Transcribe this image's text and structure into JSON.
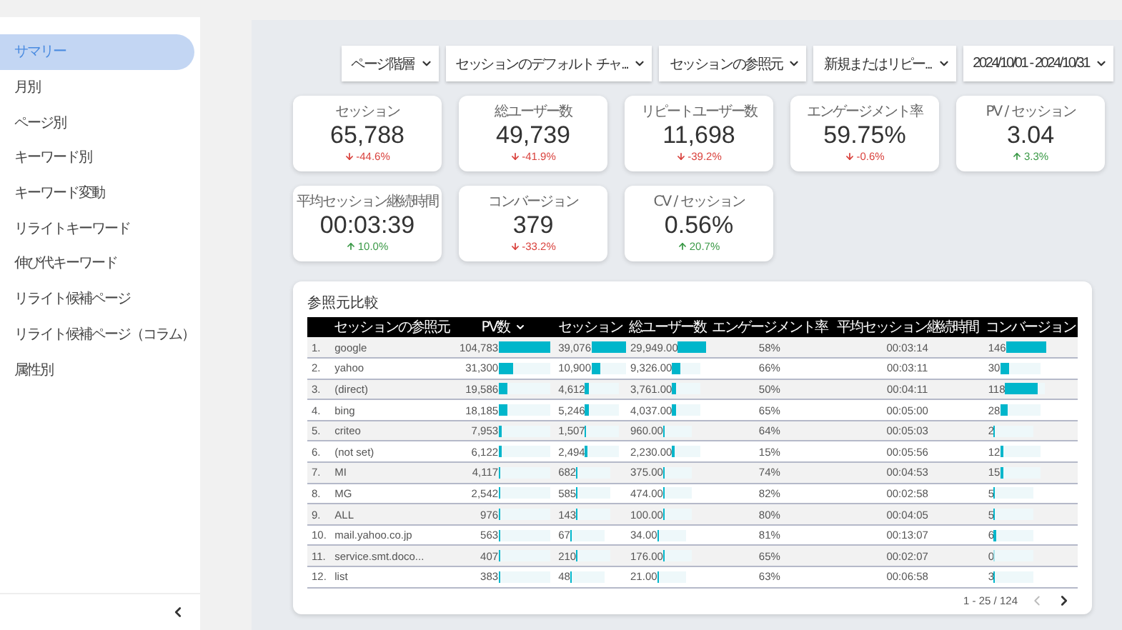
{
  "sidebar": {
    "items": [
      {
        "label": "サマリー",
        "selected": true
      },
      {
        "label": "月別",
        "selected": false
      },
      {
        "label": "ページ別",
        "selected": false
      },
      {
        "label": "キーワード別",
        "selected": false
      },
      {
        "label": "キーワード変動",
        "selected": false
      },
      {
        "label": "リライトキーワード",
        "selected": false
      },
      {
        "label": "伸び代キーワード",
        "selected": false
      },
      {
        "label": "リライト候補ページ",
        "selected": false
      },
      {
        "label": "リライト候補ページ（コラム）",
        "selected": false
      },
      {
        "label": "属性別",
        "selected": false
      }
    ]
  },
  "filters": [
    {
      "label": "ページ階層"
    },
    {
      "label": "セッションのデフォルト チャ..."
    },
    {
      "label": "セッションの参照元"
    },
    {
      "label": "新規またはリピー..."
    },
    {
      "label": "2024/10/01 - 2024/10/31"
    }
  ],
  "kpis": [
    {
      "label": "セッション",
      "value": "65,788",
      "delta": "-44.6%",
      "increase": false
    },
    {
      "label": "総ユーザー数",
      "value": "49,739",
      "delta": "-41.9%",
      "increase": false
    },
    {
      "label": "リピートユーザー数",
      "value": "11,698",
      "delta": "-39.2%",
      "increase": false
    },
    {
      "label": "エンゲージメント率",
      "value": "59.75%",
      "delta": "-0.6%",
      "increase": false
    },
    {
      "label": "PV / セッション",
      "value": "3.04",
      "delta": "3.3%",
      "increase": true
    },
    {
      "label": "平均セッション継続時間",
      "value": "00:03:39",
      "delta": "10.0%",
      "increase": true
    },
    {
      "label": "コンバージョン",
      "value": "379",
      "delta": "-33.2%",
      "increase": false
    },
    {
      "label": "CV / セッション",
      "value": "0.56%",
      "delta": "20.7%",
      "increase": true
    }
  ],
  "table": {
    "title": "参照元比較",
    "columns": [
      {
        "label": "セッションの参照元",
        "sorted": false
      },
      {
        "label": "PV数",
        "sorted": true
      },
      {
        "label": "セッション",
        "sorted": false
      },
      {
        "label": "総ユーザー数",
        "sorted": false
      },
      {
        "label": "エンゲージメント率",
        "sorted": false
      },
      {
        "label": "平均セッション継続時間",
        "sorted": false
      },
      {
        "label": "コンバージョン",
        "sorted": false
      }
    ],
    "rows": [
      {
        "index": "1.",
        "source": "google",
        "pv": {
          "text": "104,783",
          "level": 1
        },
        "sessions": {
          "text": "39,076",
          "level": 1
        },
        "users": {
          "text": "29,949.00",
          "level": 1
        },
        "engagement": "58%",
        "duration": "00:03:14",
        "conversions": {
          "text": "146",
          "level": 1
        }
      },
      {
        "index": "2.",
        "source": "yahoo",
        "pv": {
          "text": "31,300",
          "level": 0.3
        },
        "sessions": {
          "text": "10,900",
          "level": 0.28
        },
        "users": {
          "text": "9,326.00",
          "level": 0.31
        },
        "engagement": "66%",
        "duration": "00:03:11",
        "conversions": {
          "text": "30",
          "level": 0.21
        }
      },
      {
        "index": "3.",
        "source": "(direct)",
        "pv": {
          "text": "19,586",
          "level": 0.19
        },
        "sessions": {
          "text": "4,612",
          "level": 0.12
        },
        "users": {
          "text": "3,761.00",
          "level": 0.13
        },
        "engagement": "50%",
        "duration": "00:04:11",
        "conversions": {
          "text": "118",
          "level": 0.81
        }
      },
      {
        "index": "4.",
        "source": "bing",
        "pv": {
          "text": "18,185",
          "level": 0.17
        },
        "sessions": {
          "text": "5,246",
          "level": 0.13
        },
        "users": {
          "text": "4,037.00",
          "level": 0.13
        },
        "engagement": "65%",
        "duration": "00:05:00",
        "conversions": {
          "text": "28",
          "level": 0.19
        }
      },
      {
        "index": "5.",
        "source": "criteo",
        "pv": {
          "text": "7,953",
          "level": 0.076
        },
        "sessions": {
          "text": "1,507",
          "level": 0.04
        },
        "users": {
          "text": "960.00",
          "level": 0.03
        },
        "engagement": "64%",
        "duration": "00:05:03",
        "conversions": {
          "text": "2",
          "level": 0.014
        }
      },
      {
        "index": "6.",
        "source": "(not set)",
        "pv": {
          "text": "6,122",
          "level": 0.058
        },
        "sessions": {
          "text": "2,494",
          "level": 0.064
        },
        "users": {
          "text": "2,230.00",
          "level": 0.074
        },
        "engagement": "15%",
        "duration": "00:05:56",
        "conversions": {
          "text": "12",
          "level": 0.08
        }
      },
      {
        "index": "7.",
        "source": "MI",
        "pv": {
          "text": "4,117",
          "level": 0.039
        },
        "sessions": {
          "text": "682",
          "level": 0.017
        },
        "users": {
          "text": "375.00",
          "level": 0.013
        },
        "engagement": "74%",
        "duration": "00:04:53",
        "conversions": {
          "text": "15",
          "level": 0.1
        }
      },
      {
        "index": "8.",
        "source": "MG",
        "pv": {
          "text": "2,542",
          "level": 0.024
        },
        "sessions": {
          "text": "585",
          "level": 0.015
        },
        "users": {
          "text": "474.00",
          "level": 0.016
        },
        "engagement": "82%",
        "duration": "00:02:58",
        "conversions": {
          "text": "5",
          "level": 0.034
        }
      },
      {
        "index": "9.",
        "source": "ALL",
        "pv": {
          "text": "976",
          "level": 0.009
        },
        "sessions": {
          "text": "143",
          "level": 0.004
        },
        "users": {
          "text": "100.00",
          "level": 0.003
        },
        "engagement": "80%",
        "duration": "00:04:05",
        "conversions": {
          "text": "5",
          "level": 0.034
        }
      },
      {
        "index": "10.",
        "source": "mail.yahoo.co.jp",
        "pv": {
          "text": "563",
          "level": 0.005
        },
        "sessions": {
          "text": "67",
          "level": 0.002
        },
        "users": {
          "text": "34.00",
          "level": 0.001
        },
        "engagement": "81%",
        "duration": "00:13:07",
        "conversions": {
          "text": "6",
          "level": 0.04
        }
      },
      {
        "index": "11.",
        "source": "service.smt.doco...",
        "pv": {
          "text": "407",
          "level": 0.004
        },
        "sessions": {
          "text": "210",
          "level": 0.005
        },
        "users": {
          "text": "176.00",
          "level": 0.006
        },
        "engagement": "65%",
        "duration": "00:02:07",
        "conversions": {
          "text": "0",
          "level": 0
        }
      },
      {
        "index": "12.",
        "source": "list",
        "pv": {
          "text": "383",
          "level": 0.004
        },
        "sessions": {
          "text": "48",
          "level": 0.001
        },
        "users": {
          "text": "21.00",
          "level": 0.001
        },
        "engagement": "63%",
        "duration": "00:06:58",
        "conversions": {
          "text": "3",
          "level": 0.02
        }
      }
    ],
    "pagination": {
      "range": "1 - 25 / 124",
      "prev_disabled": true
    }
  }
}
